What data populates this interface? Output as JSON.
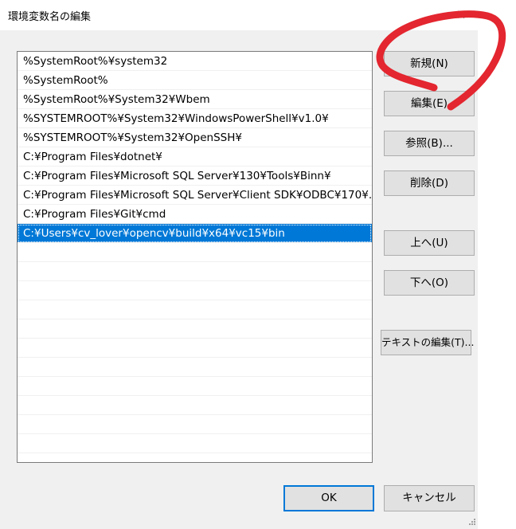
{
  "dialog": {
    "title": "環境変数名の編集",
    "close_glyph": "✕"
  },
  "path_list": {
    "items": [
      {
        "label": "%SystemRoot%¥system32",
        "selected": false
      },
      {
        "label": "%SystemRoot%",
        "selected": false
      },
      {
        "label": "%SystemRoot%¥System32¥Wbem",
        "selected": false
      },
      {
        "label": "%SYSTEMROOT%¥System32¥WindowsPowerShell¥v1.0¥",
        "selected": false
      },
      {
        "label": "%SYSTEMROOT%¥System32¥OpenSSH¥",
        "selected": false
      },
      {
        "label": "C:¥Program Files¥dotnet¥",
        "selected": false
      },
      {
        "label": "C:¥Program Files¥Microsoft SQL Server¥130¥Tools¥Binn¥",
        "selected": false
      },
      {
        "label": "C:¥Program Files¥Microsoft SQL Server¥Client SDK¥ODBC¥170¥...",
        "selected": false
      },
      {
        "label": "C:¥Program Files¥Git¥cmd",
        "selected": false
      },
      {
        "label": "C:¥Users¥cv_lover¥opencv¥build¥x64¥vc15¥bin",
        "selected": true
      }
    ],
    "empty_rows": 11
  },
  "buttons": {
    "new_label": "新規(N)",
    "edit_label": "編集(E)",
    "browse_label": "参照(B)...",
    "delete_label": "削除(D)",
    "move_up_label": "上へ(U)",
    "move_down_label": "下へ(O)",
    "edit_text_label": "テキストの編集(T)...",
    "ok_label": "OK",
    "cancel_label": "キャンセル"
  },
  "colors": {
    "selection": "#0078d7",
    "annotation_stroke": "#e3262f",
    "default_button_border": "#0078d7"
  }
}
